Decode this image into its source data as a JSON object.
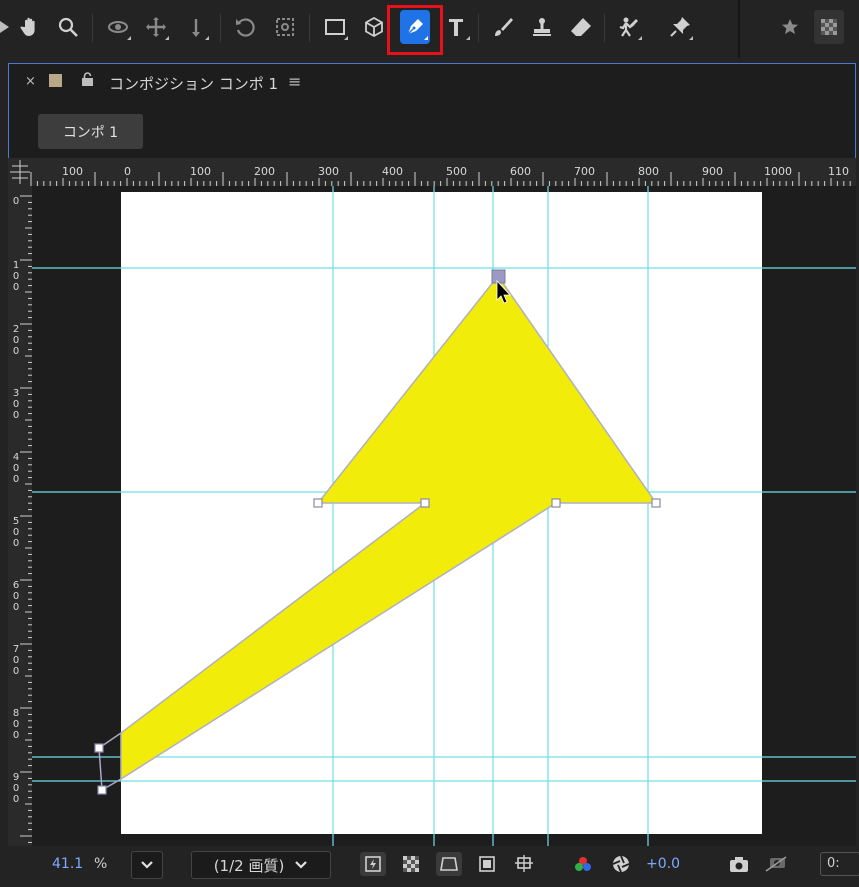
{
  "toolbar": {
    "tools": [
      "home-tool",
      "hand-tool",
      "zoom-tool",
      "orbit-camera-tool",
      "pan-camera-tool",
      "dolly-camera-tool",
      "rotation-tool",
      "pan-behind-tool",
      "rectangle-tool",
      "3d-tool",
      "pen-tool",
      "type-tool",
      "brush-tool",
      "clone-stamp-tool",
      "eraser-tool",
      "puppet-tool",
      "pin-tool",
      "workspace-star",
      "snapping-toggle"
    ],
    "active_tool": "pen-tool",
    "active_color": "#1f73e6",
    "highlight_color": "#e5121b"
  },
  "panel": {
    "close": "×",
    "title": "コンポジション コンポ 1",
    "menu": "≡",
    "tab_label": "コンポ 1",
    "border_color": "#4a7bd0"
  },
  "ruler": {
    "h_labels": [
      "100",
      "0",
      "100",
      "200",
      "300",
      "400",
      "500",
      "600",
      "700",
      "800",
      "900",
      "1000",
      "110"
    ],
    "v_labels": [
      "0",
      "1\n0\n0",
      "2\n0\n0",
      "3\n0\n0",
      "4\n0\n0",
      "5\n0\n0",
      "6\n0\n0",
      "7\n0\n0",
      "8\n0\n0",
      "9\n0\n0"
    ]
  },
  "canvas": {
    "background": "#ffffff",
    "shape_fill": "#f2ec0a",
    "guide_color": "#6fe0e8"
  },
  "bottom_bar": {
    "zoom_value": "41.1",
    "zoom_unit": "%",
    "resolution": "(1/2 画質)",
    "exposure": "+0.0",
    "timecode": "0:"
  }
}
